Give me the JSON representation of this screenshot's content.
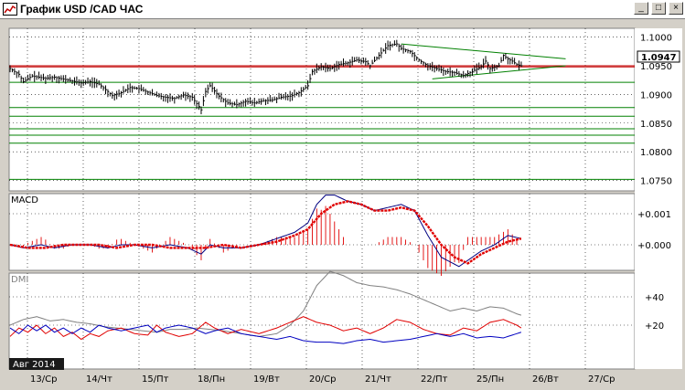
{
  "window": {
    "title": "График USD /CAD  ЧАС",
    "buttons": {
      "minimize": "_",
      "maximize": "□",
      "close": "×"
    }
  },
  "colors": {
    "price": "#000000",
    "hline": "#008000",
    "triangle": "#008000",
    "current": "#c00000",
    "macd": "#000080",
    "signal": "#e00000",
    "hist": "#e00000",
    "dmi_adx": "#808080",
    "dmi_plus": "#e00000",
    "dmi_minus": "#0000c0",
    "grid": "#000000",
    "axis_bg": "#ffffff"
  },
  "price_panel": {
    "ticks": [
      "1.1000",
      "1.0950",
      "1.0900",
      "1.0850",
      "1.0800",
      "1.0750"
    ],
    "current_price": "1.0947"
  },
  "macd_panel": {
    "label": "MACD",
    "ticks": [
      "+0.001",
      "+0.000"
    ]
  },
  "dmi_panel": {
    "label": "DMI",
    "ticks": [
      "+40",
      "+20"
    ]
  },
  "period_label": "Авг 2014",
  "x_axis": {
    "labels": [
      "13/Ср",
      "14/Чт",
      "15/Пт",
      "18/Пн",
      "19/Вт",
      "20/Ср",
      "21/Чт",
      "22/Пт",
      "25/Пн",
      "26/Вт",
      "27/Ср"
    ]
  },
  "chart_data": {
    "type": "line",
    "title": "График USD /CAD  ЧАС",
    "x": [
      "13/Ср",
      "14/Чт",
      "15/Пт",
      "18/Пн",
      "19/Вт",
      "20/Ср",
      "21/Чт",
      "22/Пт",
      "25/Пн",
      "26/Вт",
      "27/Ср"
    ],
    "ylim": [
      1.0735,
      1.1012
    ],
    "grid": true,
    "series": [
      {
        "values": [
          1.0942,
          1.0925,
          1.091,
          1.089,
          1.0895,
          1.0945,
          1.0985,
          1.0945,
          1.0952,
          null,
          null
        ]
      }
    ],
    "horizontal_levels": [
      1.095,
      1.0948,
      1.0921,
      1.0877,
      1.0862,
      1.084,
      1.0829,
      1.0815,
      1.0752
    ],
    "price_path": [
      [
        0,
        1.0945
      ],
      [
        4,
        1.0935
      ],
      [
        6,
        1.0922
      ],
      [
        10,
        1.0932
      ],
      [
        16,
        1.0928
      ],
      [
        20,
        1.093
      ],
      [
        26,
        1.0925
      ],
      [
        32,
        1.092
      ],
      [
        36,
        1.0922
      ],
      [
        40,
        1.0918
      ],
      [
        44,
        1.0905
      ],
      [
        46,
        1.0898
      ],
      [
        50,
        1.0903
      ],
      [
        54,
        1.0912
      ],
      [
        58,
        1.091
      ],
      [
        62,
        1.0904
      ],
      [
        66,
        1.0898
      ],
      [
        70,
        1.0895
      ],
      [
        74,
        1.0893
      ],
      [
        78,
        1.0899
      ],
      [
        82,
        1.0895
      ],
      [
        86,
        1.0873
      ],
      [
        88,
        1.0905
      ],
      [
        90,
        1.0915
      ],
      [
        94,
        1.0897
      ],
      [
        98,
        1.0885
      ],
      [
        102,
        1.0882
      ],
      [
        106,
        1.0888
      ],
      [
        110,
        1.0885
      ],
      [
        114,
        1.0889
      ],
      [
        118,
        1.089
      ],
      [
        122,
        1.0895
      ],
      [
        126,
        1.0897
      ],
      [
        130,
        1.0903
      ],
      [
        134,
        1.0915
      ],
      [
        136,
        1.094
      ],
      [
        140,
        1.0948
      ],
      [
        144,
        1.0945
      ],
      [
        148,
        1.0952
      ],
      [
        152,
        1.0955
      ],
      [
        156,
        1.096
      ],
      [
        160,
        1.0957
      ],
      [
        162,
        1.095
      ],
      [
        166,
        1.0968
      ],
      [
        170,
        1.0985
      ],
      [
        174,
        1.0988
      ],
      [
        176,
        1.098
      ],
      [
        180,
        1.0975
      ],
      [
        184,
        1.096
      ],
      [
        188,
        1.095
      ],
      [
        192,
        1.0945
      ],
      [
        196,
        1.094
      ],
      [
        200,
        1.0938
      ],
      [
        204,
        1.0933
      ],
      [
        208,
        1.094
      ],
      [
        212,
        1.0948
      ],
      [
        214,
        1.0958
      ],
      [
        216,
        1.0945
      ],
      [
        220,
        1.095
      ],
      [
        222,
        1.0968
      ],
      [
        224,
        1.0962
      ],
      [
        226,
        1.0958
      ],
      [
        228,
        1.0952
      ],
      [
        230,
        1.095
      ]
    ],
    "macd": [
      [
        0,
        0.0
      ],
      [
        6,
        -0.0001
      ],
      [
        14,
        0.0
      ],
      [
        20,
        -0.0001
      ],
      [
        28,
        0.0
      ],
      [
        36,
        0.0
      ],
      [
        44,
        -0.0001
      ],
      [
        50,
        0.0
      ],
      [
        56,
        0.0
      ],
      [
        64,
        -0.0001
      ],
      [
        72,
        0.0
      ],
      [
        80,
        -0.0001
      ],
      [
        86,
        -0.0003
      ],
      [
        90,
        0.0
      ],
      [
        96,
        -0.0001
      ],
      [
        104,
        -0.0001
      ],
      [
        112,
        0.0
      ],
      [
        120,
        0.0002
      ],
      [
        128,
        0.0004
      ],
      [
        134,
        0.0007
      ],
      [
        138,
        0.0013
      ],
      [
        142,
        0.0016
      ],
      [
        146,
        0.0016
      ],
      [
        152,
        0.0014
      ],
      [
        158,
        0.0013
      ],
      [
        164,
        0.0011
      ],
      [
        170,
        0.0012
      ],
      [
        176,
        0.0013
      ],
      [
        182,
        0.0011
      ],
      [
        188,
        0.0003
      ],
      [
        194,
        -0.0004
      ],
      [
        202,
        -0.0007
      ],
      [
        206,
        -0.0005
      ],
      [
        212,
        -0.0002
      ],
      [
        218,
        0.0
      ],
      [
        224,
        0.0003
      ],
      [
        230,
        0.0002
      ]
    ],
    "signal": [
      [
        0,
        0.0
      ],
      [
        8,
        -0.0001
      ],
      [
        16,
        -0.0001
      ],
      [
        24,
        0.0
      ],
      [
        32,
        0.0
      ],
      [
        40,
        0.0
      ],
      [
        48,
        -0.0001
      ],
      [
        56,
        0.0
      ],
      [
        64,
        0.0
      ],
      [
        72,
        -0.0001
      ],
      [
        80,
        -0.0001
      ],
      [
        88,
        -0.0001
      ],
      [
        96,
        0.0
      ],
      [
        104,
        -0.0001
      ],
      [
        112,
        0.0
      ],
      [
        120,
        0.0001
      ],
      [
        128,
        0.0003
      ],
      [
        134,
        0.0005
      ],
      [
        140,
        0.001
      ],
      [
        146,
        0.0013
      ],
      [
        152,
        0.0014
      ],
      [
        158,
        0.0013
      ],
      [
        164,
        0.0011
      ],
      [
        170,
        0.0011
      ],
      [
        176,
        0.0012
      ],
      [
        182,
        0.0011
      ],
      [
        188,
        0.0006
      ],
      [
        194,
        0.0
      ],
      [
        200,
        -0.0004
      ],
      [
        206,
        -0.0006
      ],
      [
        212,
        -0.0003
      ],
      [
        218,
        -0.0001
      ],
      [
        224,
        0.0001
      ],
      [
        230,
        0.0002
      ]
    ],
    "dmi_adx": [
      [
        0,
        20
      ],
      [
        6,
        24
      ],
      [
        12,
        26
      ],
      [
        18,
        23
      ],
      [
        24,
        24
      ],
      [
        30,
        22
      ],
      [
        36,
        21
      ],
      [
        42,
        19
      ],
      [
        48,
        18
      ],
      [
        54,
        17
      ],
      [
        60,
        16
      ],
      [
        66,
        15
      ],
      [
        72,
        17
      ],
      [
        78,
        17
      ],
      [
        84,
        18
      ],
      [
        90,
        17
      ],
      [
        96,
        16
      ],
      [
        104,
        14
      ],
      [
        112,
        12
      ],
      [
        120,
        14
      ],
      [
        126,
        20
      ],
      [
        132,
        30
      ],
      [
        138,
        48
      ],
      [
        144,
        58
      ],
      [
        150,
        55
      ],
      [
        156,
        50
      ],
      [
        162,
        48
      ],
      [
        168,
        47
      ],
      [
        174,
        45
      ],
      [
        180,
        42
      ],
      [
        186,
        38
      ],
      [
        192,
        34
      ],
      [
        198,
        30
      ],
      [
        204,
        32
      ],
      [
        210,
        30
      ],
      [
        216,
        33
      ],
      [
        222,
        32
      ],
      [
        228,
        28
      ],
      [
        230,
        27
      ]
    ],
    "dmi_plus": [
      [
        0,
        12
      ],
      [
        4,
        18
      ],
      [
        8,
        15
      ],
      [
        12,
        20
      ],
      [
        16,
        14
      ],
      [
        20,
        18
      ],
      [
        24,
        12
      ],
      [
        28,
        15
      ],
      [
        32,
        10
      ],
      [
        36,
        14
      ],
      [
        40,
        12
      ],
      [
        44,
        16
      ],
      [
        50,
        18
      ],
      [
        56,
        14
      ],
      [
        62,
        13
      ],
      [
        66,
        20
      ],
      [
        70,
        15
      ],
      [
        76,
        12
      ],
      [
        82,
        14
      ],
      [
        88,
        22
      ],
      [
        92,
        18
      ],
      [
        98,
        14
      ],
      [
        104,
        17
      ],
      [
        112,
        14
      ],
      [
        120,
        18
      ],
      [
        126,
        22
      ],
      [
        132,
        26
      ],
      [
        138,
        22
      ],
      [
        144,
        20
      ],
      [
        150,
        16
      ],
      [
        156,
        18
      ],
      [
        162,
        14
      ],
      [
        168,
        18
      ],
      [
        174,
        24
      ],
      [
        180,
        22
      ],
      [
        186,
        17
      ],
      [
        192,
        14
      ],
      [
        198,
        13
      ],
      [
        204,
        18
      ],
      [
        210,
        16
      ],
      [
        216,
        22
      ],
      [
        222,
        24
      ],
      [
        228,
        20
      ],
      [
        230,
        18
      ]
    ],
    "dmi_minus": [
      [
        0,
        18
      ],
      [
        4,
        14
      ],
      [
        8,
        20
      ],
      [
        12,
        16
      ],
      [
        16,
        20
      ],
      [
        20,
        15
      ],
      [
        24,
        18
      ],
      [
        28,
        14
      ],
      [
        32,
        18
      ],
      [
        36,
        15
      ],
      [
        40,
        20
      ],
      [
        44,
        18
      ],
      [
        50,
        16
      ],
      [
        56,
        18
      ],
      [
        62,
        20
      ],
      [
        66,
        15
      ],
      [
        70,
        18
      ],
      [
        76,
        20
      ],
      [
        82,
        18
      ],
      [
        88,
        14
      ],
      [
        92,
        16
      ],
      [
        98,
        18
      ],
      [
        104,
        14
      ],
      [
        112,
        12
      ],
      [
        120,
        10
      ],
      [
        126,
        12
      ],
      [
        132,
        9
      ],
      [
        138,
        8
      ],
      [
        144,
        8
      ],
      [
        150,
        7
      ],
      [
        156,
        9
      ],
      [
        162,
        10
      ],
      [
        168,
        8
      ],
      [
        174,
        9
      ],
      [
        180,
        10
      ],
      [
        186,
        12
      ],
      [
        192,
        14
      ],
      [
        198,
        12
      ],
      [
        204,
        14
      ],
      [
        210,
        11
      ],
      [
        216,
        12
      ],
      [
        222,
        11
      ],
      [
        228,
        14
      ],
      [
        230,
        15
      ]
    ]
  }
}
